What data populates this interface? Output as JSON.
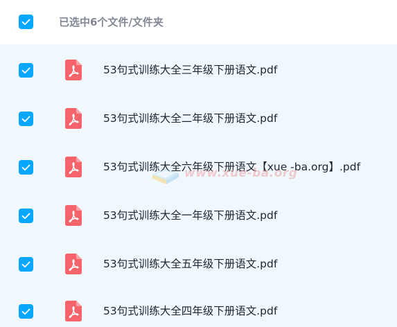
{
  "header": {
    "select_all_checked": true,
    "title": "已选中6个文件/文件夹"
  },
  "files": [
    {
      "name": "53句式训练大全三年级下册语文.pdf",
      "type": "pdf",
      "checked": true
    },
    {
      "name": "53句式训练大全二年级下册语文.pdf",
      "type": "pdf",
      "checked": true
    },
    {
      "name": "53句式训练大全六年级下册语文【xue -ba.org】.pdf",
      "type": "pdf",
      "checked": true
    },
    {
      "name": "53句式训练大全一年级下册语文.pdf",
      "type": "pdf",
      "checked": true
    },
    {
      "name": "53句式训练大全五年级下册语文.pdf",
      "type": "pdf",
      "checked": true
    },
    {
      "name": "53句式训练大全四年级下册语文.pdf",
      "type": "pdf",
      "checked": true
    }
  ],
  "watermark": {
    "text": "www.xue-ba.org"
  },
  "colors": {
    "checkbox": "#06a7ff",
    "pdf_icon": "#f4646a",
    "list_background": "#f1f8fd",
    "header_text": "#818794",
    "file_text": "#1f2430"
  },
  "icons": {
    "checkbox": "checkbox-checked-icon",
    "file": "pdf-file-icon"
  }
}
